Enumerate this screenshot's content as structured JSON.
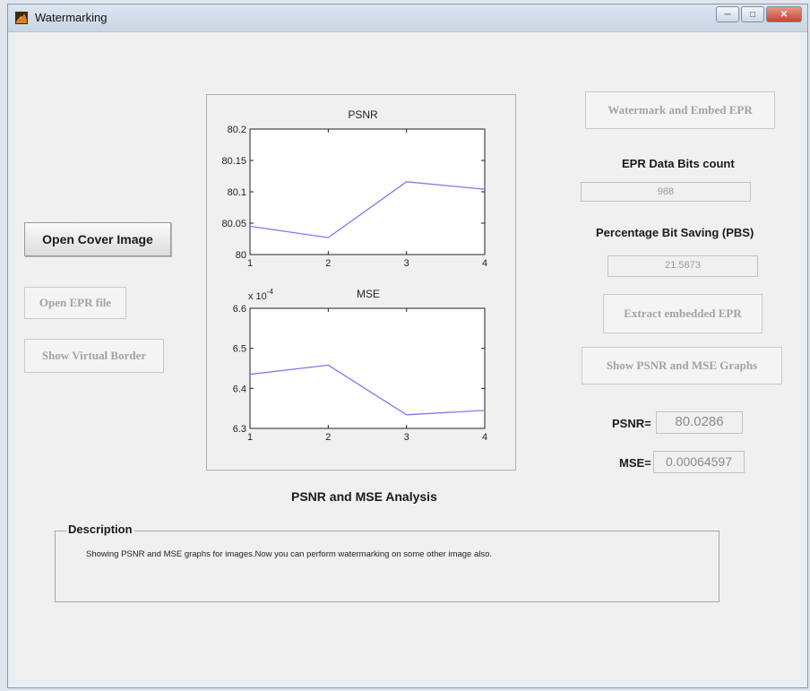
{
  "window": {
    "title": "Watermarking",
    "controls": [
      "minimize",
      "maximize",
      "close"
    ]
  },
  "left_buttons": {
    "open_cover": "Open Cover Image",
    "open_epr": "Open EPR file",
    "show_border": "Show Virtual Border"
  },
  "right": {
    "watermark_button": "Watermark and Embed EPR",
    "epr_bits_label": "EPR Data Bits count",
    "epr_bits_value": "988",
    "pbs_label": "Percentage Bit Saving (PBS)",
    "pbs_value": "21.5873",
    "extract_button": "Extract embedded EPR",
    "graphs_button": "Show PSNR and MSE Graphs",
    "psnr_label": "PSNR=",
    "psnr_value": "80.0286",
    "mse_label": "MSE=",
    "mse_value": "0.00064597"
  },
  "analysis_caption": "PSNR and MSE Analysis",
  "description": {
    "title": "Description",
    "text": "Showing PSNR and MSE graphs for   images.Now you can perform watermarking on some other image also."
  },
  "line_color": "#7b7bf0",
  "chart_data": [
    {
      "type": "line",
      "title": "PSNR",
      "x": [
        1,
        2,
        3,
        4
      ],
      "xticks": [
        "1",
        "2",
        "3",
        "4"
      ],
      "series": [
        {
          "values": [
            80.045,
            80.027,
            80.116,
            80.104
          ]
        }
      ],
      "ylim": [
        80,
        80.2
      ],
      "yticks": [
        "80",
        "80.05",
        "80.1",
        "80.15",
        "80.2"
      ],
      "grid": false
    },
    {
      "type": "line",
      "title": "MSE",
      "x": [
        1,
        2,
        3,
        4
      ],
      "xticks": [
        "1",
        "2",
        "3",
        "4"
      ],
      "series": [
        {
          "values": [
            6.435,
            6.458,
            6.334,
            6.345
          ]
        }
      ],
      "ylim": [
        6.3,
        6.6
      ],
      "yticks": [
        "6.3",
        "6.4",
        "6.5",
        "6.6"
      ],
      "exponent_label": "x 10",
      "exponent": "-4",
      "grid": false
    }
  ]
}
